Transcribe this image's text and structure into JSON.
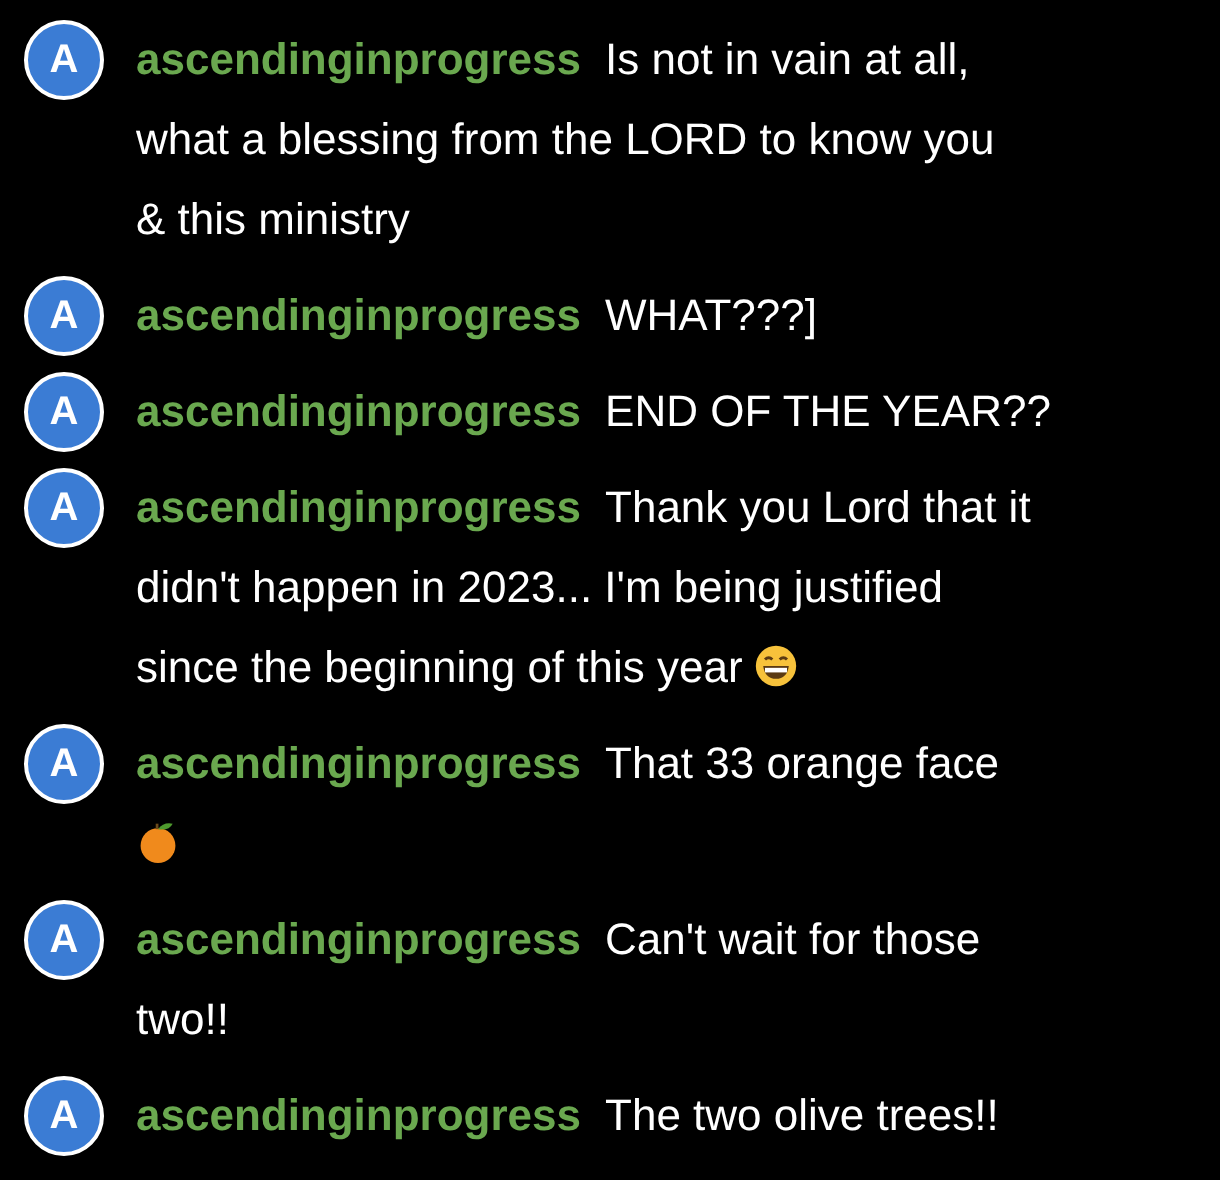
{
  "messages": [
    {
      "kind": "plain",
      "avatar": "A",
      "username": "ascendinginprogress",
      "lines": [
        "Is not in vain at all,",
        "what a blessing from the LORD to know you",
        "& this ministry"
      ]
    },
    {
      "kind": "plain",
      "avatar": "A",
      "username": "ascendinginprogress",
      "lines": [
        "WHAT???]"
      ]
    },
    {
      "kind": "plain",
      "avatar": "A",
      "username": "ascendinginprogress",
      "lines": [
        "END OF THE YEAR??"
      ]
    },
    {
      "kind": "grin",
      "avatar": "A",
      "username": "ascendinginprogress",
      "lines": [
        "Thank you Lord that it",
        "didn't happen in 2023... I'm being justified",
        "since the beginning of this year"
      ]
    },
    {
      "kind": "fruit",
      "avatar": "A",
      "username": "ascendinginprogress",
      "lines": [
        "That 33 orange face"
      ]
    },
    {
      "kind": "plain",
      "avatar": "A",
      "username": "ascendinginprogress",
      "lines": [
        "Can't wait for those",
        "two!!"
      ]
    },
    {
      "kind": "plain",
      "avatar": "A",
      "username": "ascendinginprogress",
      "lines": [
        "The two olive trees!!"
      ]
    }
  ]
}
